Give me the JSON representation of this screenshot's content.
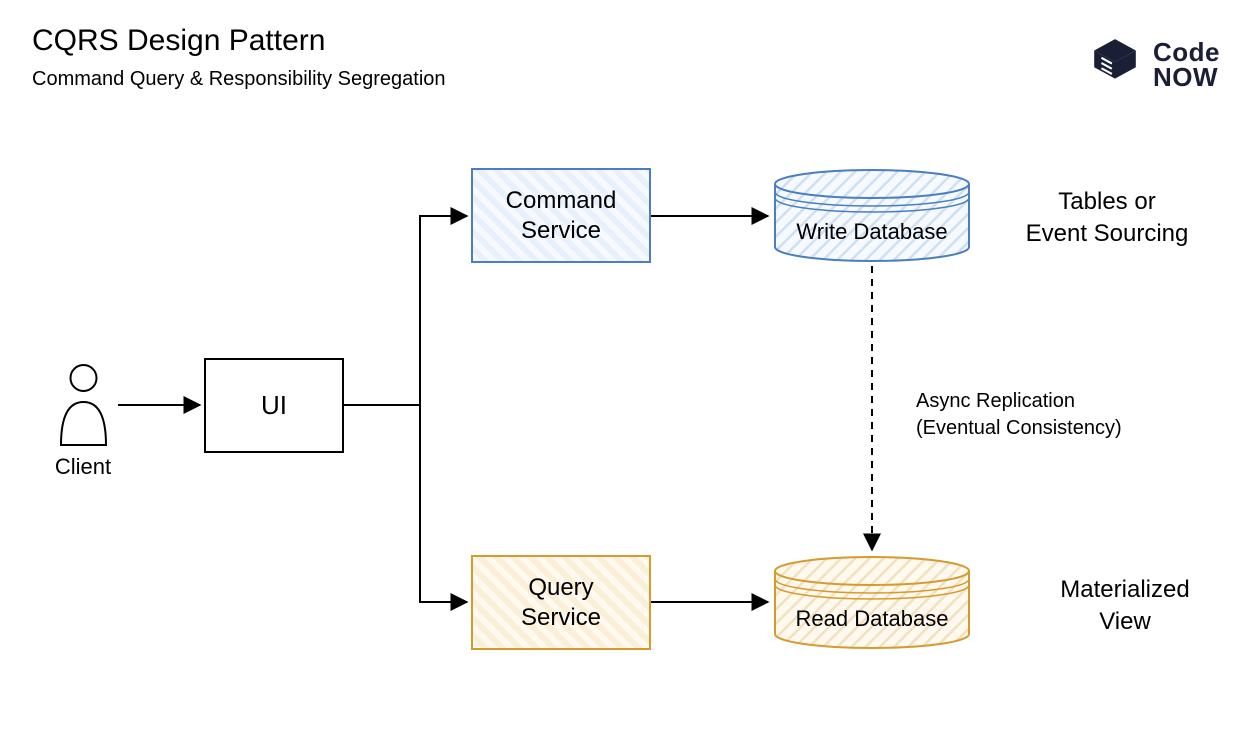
{
  "header": {
    "title": "CQRS Design Pattern",
    "subtitle": "Command Query & Responsibility Segregation"
  },
  "logo": {
    "line1": "Code",
    "line2": "NOW"
  },
  "nodes": {
    "client_label": "Client",
    "ui_label": "UI",
    "command_service_label": "Command\nService",
    "query_service_label": "Query\nService",
    "write_db_label": "Write Database",
    "read_db_label": "Read Database"
  },
  "annotations": {
    "write_db_note": "Tables or\nEvent Sourcing",
    "replication_note": "Async Replication\n(Eventual Consistency)",
    "read_db_note": "Materialized\nView"
  },
  "colors": {
    "blue": "#4a7ec1",
    "orange": "#d79a2c",
    "dark": "#1a1f36"
  }
}
